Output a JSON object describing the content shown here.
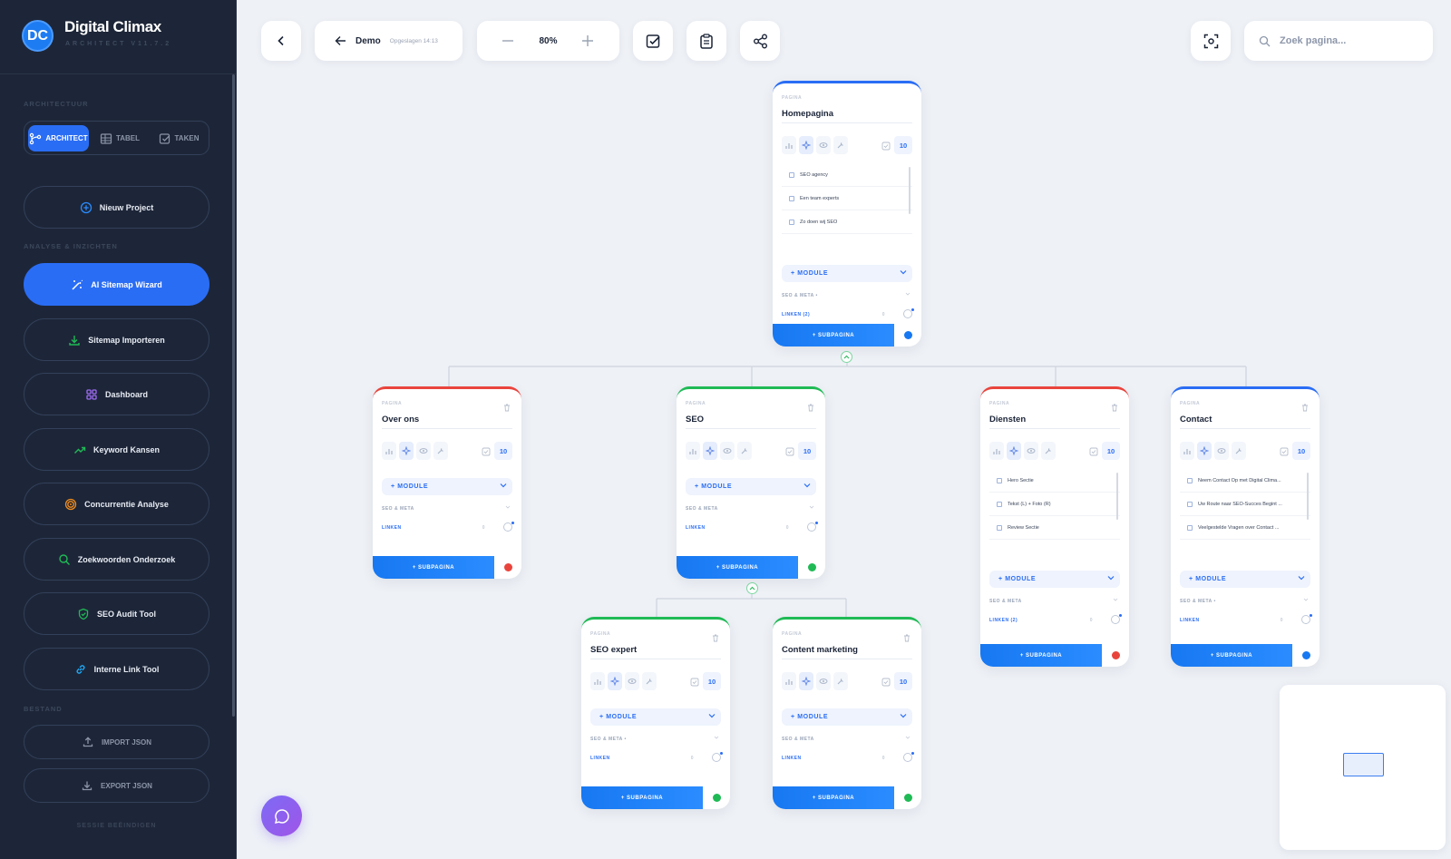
{
  "brand": {
    "logo": "DC",
    "name": "Digital Climax",
    "version": "ARCHITECT V11.7.2"
  },
  "sidebar": {
    "section_architecture": "ARCHITECTUUR",
    "tabs": [
      {
        "label": "ARCHITECT",
        "icon": "architect-icon",
        "active": true
      },
      {
        "label": "TABEL",
        "icon": "table-icon",
        "active": false
      },
      {
        "label": "TAKEN",
        "icon": "tasks-icon",
        "active": false
      }
    ],
    "new_project": "Nieuw Project",
    "section_analysis": "ANALYSE & INZICHTEN",
    "nav": [
      {
        "label": "AI Sitemap Wizard",
        "icon": "magic-wand-icon",
        "color": "#ffffff"
      },
      {
        "label": "Sitemap Importeren",
        "icon": "download-icon",
        "color": "#1fba55"
      },
      {
        "label": "Dashboard",
        "icon": "grid-icon",
        "color": "#a06cf5"
      },
      {
        "label": "Keyword Kansen",
        "icon": "trending-up-icon",
        "color": "#1fba55"
      },
      {
        "label": "Concurrentie Analyse",
        "icon": "target-icon",
        "color": "#f08c1c"
      },
      {
        "label": "Zoekwoorden Onderzoek",
        "icon": "search-icon",
        "color": "#1fba55"
      },
      {
        "label": "SEO Audit Tool",
        "icon": "shield-check-icon",
        "color": "#1fba55"
      },
      {
        "label": "Interne Link Tool",
        "icon": "link-icon",
        "color": "#1fa7f5"
      }
    ],
    "section_file": "BESTAND",
    "import_json": "IMPORT JSON",
    "export_json": "EXPORT JSON",
    "end_session": "SESSIE BEËINDIGEN"
  },
  "toolbar": {
    "project_name": "Demo",
    "saved_status": "Opgeslagen 14:13",
    "zoom": "80%",
    "search_placeholder": "Zoek pagina..."
  },
  "colors": {
    "accent": "#2a6df5",
    "success": "#1fba55",
    "danger": "#e9443c",
    "sidebar_bg": "#1d2638"
  },
  "pages": {
    "home": {
      "label": "PAGINA",
      "title": "Homepagina",
      "count": "10",
      "modules": [
        "SEO agency",
        "Een team experts",
        "Zo doen wij SEO"
      ],
      "module_btn": "+ MODULE",
      "seo": "SEO & META •",
      "links": "LINKEN (2)",
      "link_count": "0",
      "sub": "+ SUBPAGINA",
      "status": "blue"
    },
    "over": {
      "label": "PAGINA",
      "title": "Over ons",
      "count": "10",
      "module_btn": "+ MODULE",
      "seo": "SEO & META",
      "links": "LINKEN",
      "link_count": "0",
      "sub": "+ SUBPAGINA",
      "status": "red"
    },
    "seo": {
      "label": "PAGINA",
      "title": "SEO",
      "count": "10",
      "module_btn": "+ MODULE",
      "seo": "SEO & META",
      "links": "LINKEN",
      "link_count": "0",
      "sub": "+ SUBPAGINA",
      "status": "green"
    },
    "diensten": {
      "label": "PAGINA",
      "title": "Diensten",
      "count": "10",
      "modules": [
        "Hero Sectie",
        "Tekst (L) + Foto (R)",
        "Review Sectie"
      ],
      "module_btn": "+ MODULE",
      "seo": "SEO & META",
      "links": "LINKEN (2)",
      "link_count": "0",
      "sub": "+ SUBPAGINA",
      "status": "red"
    },
    "contact": {
      "label": "PAGINA",
      "title": "Contact",
      "count": "10",
      "modules": [
        "Neem Contact Op met Digital Clima...",
        "Uw Route naar SEO-Succes Begint ...",
        "Veelgestelde Vragen over Contact ..."
      ],
      "module_btn": "+ MODULE",
      "seo": "SEO & META •",
      "links": "LINKEN",
      "link_count": "0",
      "sub": "+ SUBPAGINA",
      "status": "blue"
    },
    "expert": {
      "label": "PAGINA",
      "title": "SEO expert",
      "count": "10",
      "module_btn": "+ MODULE",
      "seo": "SEO & META •",
      "links": "LINKEN",
      "link_count": "0",
      "sub": "+ SUBPAGINA",
      "status": "green"
    },
    "content": {
      "label": "PAGINA",
      "title": "Content marketing",
      "count": "10",
      "module_btn": "+ MODULE",
      "seo": "SEO & META",
      "links": "LINKEN",
      "link_count": "0",
      "sub": "+ SUBPAGINA",
      "status": "green"
    }
  }
}
